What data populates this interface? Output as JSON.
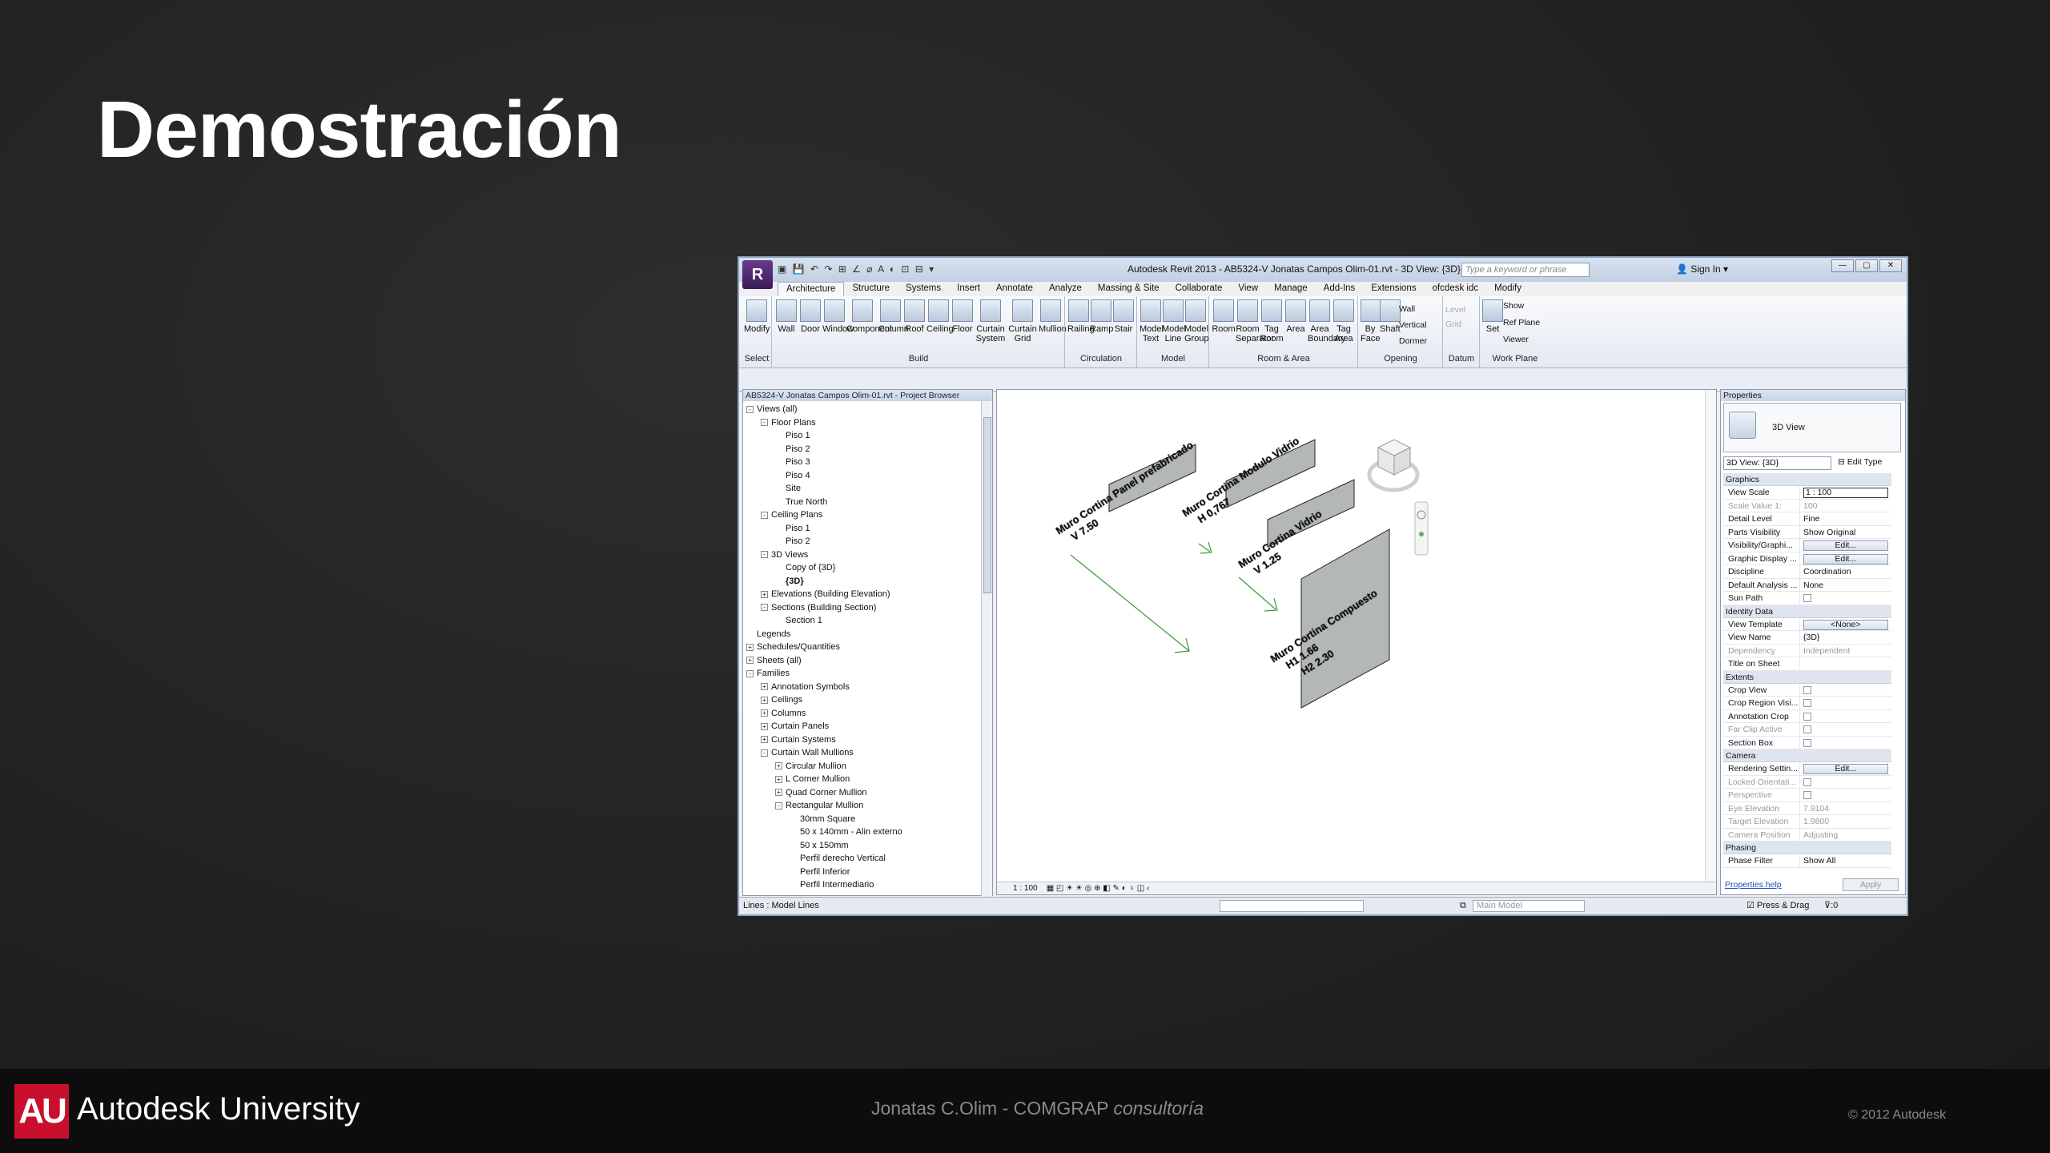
{
  "slide": {
    "title": "Demostración",
    "brand": "Autodesk University",
    "brand_logo": "AU",
    "presenter_name": "Jonatas C.Olim - COMGRAP",
    "presenter_role": "consultoría",
    "copyright": "© 2012 Autodesk"
  },
  "revit": {
    "window_title": "Autodesk Revit 2013 -    AB5324-V Jonatas Campos Olim-01.rvt - 3D View: {3D}",
    "search_placeholder": "Type a keyword or phrase",
    "sign_in": "Sign In",
    "tabs": [
      "Architecture",
      "Structure",
      "Systems",
      "Insert",
      "Annotate",
      "Analyze",
      "Massing & Site",
      "Collaborate",
      "View",
      "Manage",
      "Add-Ins",
      "Extensions",
      "ofcdesk idc",
      "Modify"
    ],
    "ribbon": {
      "modify": "Modify",
      "build": [
        "Wall",
        "Door",
        "Window",
        "Component",
        "Column",
        "Roof",
        "Ceiling",
        "Floor",
        "Curtain System",
        "Curtain Grid",
        "Mullion"
      ],
      "circulation": [
        "Railing",
        "Ramp",
        "Stair"
      ],
      "model": [
        "Model Text",
        "Model Line",
        "Model Group"
      ],
      "room": [
        "Room",
        "Room Separator",
        "Tag Room",
        "Area",
        "Area Boundary",
        "Tag Area"
      ],
      "opening": [
        "By Face",
        "Shaft",
        "Wall",
        "Vertical",
        "Dormer"
      ],
      "datum": [
        "Level",
        "Grid"
      ],
      "workplane": [
        "Set",
        "Show",
        "Ref Plane",
        "Viewer"
      ],
      "panels": [
        "Select",
        "Build",
        "Circulation",
        "Model",
        "Room & Area",
        "Opening",
        "Datum",
        "Work Plane"
      ]
    },
    "project_browser": {
      "title": "AB5324-V Jonatas Campos Olim-01.rvt - Project Browser",
      "items": [
        {
          "t": "Views (all)",
          "l": 0,
          "s": "-"
        },
        {
          "t": "Floor Plans",
          "l": 1,
          "s": "-"
        },
        {
          "t": "Piso 1",
          "l": 2,
          "s": ""
        },
        {
          "t": "Piso 2",
          "l": 2,
          "s": ""
        },
        {
          "t": "Piso 3",
          "l": 2,
          "s": ""
        },
        {
          "t": "Piso 4",
          "l": 2,
          "s": ""
        },
        {
          "t": "Site",
          "l": 2,
          "s": ""
        },
        {
          "t": "True North",
          "l": 2,
          "s": ""
        },
        {
          "t": "Ceiling Plans",
          "l": 1,
          "s": "-"
        },
        {
          "t": "Piso 1",
          "l": 2,
          "s": ""
        },
        {
          "t": "Piso 2",
          "l": 2,
          "s": ""
        },
        {
          "t": "3D Views",
          "l": 1,
          "s": "-"
        },
        {
          "t": "Copy of {3D}",
          "l": 2,
          "s": ""
        },
        {
          "t": "{3D}",
          "l": 2,
          "s": "",
          "b": true
        },
        {
          "t": "Elevations (Building Elevation)",
          "l": 1,
          "s": "+"
        },
        {
          "t": "Sections (Building Section)",
          "l": 1,
          "s": "-"
        },
        {
          "t": "Section 1",
          "l": 2,
          "s": ""
        },
        {
          "t": "Legends",
          "l": 0,
          "s": ""
        },
        {
          "t": "Schedules/Quantities",
          "l": 0,
          "s": "+"
        },
        {
          "t": "Sheets (all)",
          "l": 0,
          "s": "+"
        },
        {
          "t": "Families",
          "l": 0,
          "s": "-"
        },
        {
          "t": "Annotation Symbols",
          "l": 1,
          "s": "+"
        },
        {
          "t": "Ceilings",
          "l": 1,
          "s": "+"
        },
        {
          "t": "Columns",
          "l": 1,
          "s": "+"
        },
        {
          "t": "Curtain Panels",
          "l": 1,
          "s": "+"
        },
        {
          "t": "Curtain Systems",
          "l": 1,
          "s": "+"
        },
        {
          "t": "Curtain Wall Mullions",
          "l": 1,
          "s": "-"
        },
        {
          "t": "Circular Mullion",
          "l": 2,
          "s": "+"
        },
        {
          "t": "L Corner Mullion",
          "l": 2,
          "s": "+"
        },
        {
          "t": "Quad Corner Mullion",
          "l": 2,
          "s": "+"
        },
        {
          "t": "Rectangular Mullion",
          "l": 2,
          "s": "-"
        },
        {
          "t": "30mm Square",
          "l": 3,
          "s": ""
        },
        {
          "t": "50 x 140mm - Alin externo",
          "l": 3,
          "s": ""
        },
        {
          "t": "50 x 150mm",
          "l": 3,
          "s": ""
        },
        {
          "t": "Perfil derecho Vertical",
          "l": 3,
          "s": ""
        },
        {
          "t": "Perfil Inferior",
          "l": 3,
          "s": ""
        },
        {
          "t": "Perfil Intermediario",
          "l": 3,
          "s": ""
        }
      ]
    },
    "view": {
      "annotations": [
        {
          "l1": "Muro Cortina Panel prefabricado",
          "l2": "V 7.50",
          "l3": ""
        },
        {
          "l1": "Muro Cortina Modulo Vidrio",
          "l2": "H 0,767",
          "l3": ""
        },
        {
          "l1": "Muro Cortina Vidrio",
          "l2": "V 1.25",
          "l3": ""
        },
        {
          "l1": "Muro Cortina Compuesto",
          "l2": "H1 1.66",
          "l3": "H2 2.30"
        }
      ],
      "scale": "1 : 100",
      "viewcube_faces": [
        "TOP",
        "FRONT",
        "RIGHT"
      ]
    },
    "properties": {
      "title": "Properties",
      "type_name": "3D View",
      "instance": "3D View: {3D}",
      "edit_type": "Edit Type",
      "groups": [
        {
          "name": "Graphics",
          "rows": [
            {
              "k": "View Scale",
              "v": "1 : 100",
              "kind": "input"
            },
            {
              "k": "Scale Value    1:",
              "v": "100",
              "kind": "dim"
            },
            {
              "k": "Detail Level",
              "v": "Fine"
            },
            {
              "k": "Parts Visibility",
              "v": "Show Original"
            },
            {
              "k": "Visibility/Graphi...",
              "v": "Edit...",
              "kind": "btn"
            },
            {
              "k": "Graphic Display ...",
              "v": "Edit...",
              "kind": "btn"
            },
            {
              "k": "Discipline",
              "v": "Coordination"
            },
            {
              "k": "Default Analysis ...",
              "v": "None"
            },
            {
              "k": "Sun Path",
              "v": "",
              "kind": "chk"
            }
          ]
        },
        {
          "name": "Identity Data",
          "rows": [
            {
              "k": "View Template",
              "v": "<None>",
              "kind": "btn"
            },
            {
              "k": "View Name",
              "v": "{3D}"
            },
            {
              "k": "Dependency",
              "v": "Independent",
              "kind": "dim"
            },
            {
              "k": "Title on Sheet",
              "v": ""
            }
          ]
        },
        {
          "name": "Extents",
          "rows": [
            {
              "k": "Crop View",
              "v": "",
              "kind": "chk"
            },
            {
              "k": "Crop Region Visi...",
              "v": "",
              "kind": "chk"
            },
            {
              "k": "Annotation Crop",
              "v": "",
              "kind": "chk"
            },
            {
              "k": "Far Clip Active",
              "v": "",
              "kind": "chkdim"
            },
            {
              "k": "Section Box",
              "v": "",
              "kind": "chk"
            }
          ]
        },
        {
          "name": "Camera",
          "rows": [
            {
              "k": "Rendering Settin...",
              "v": "Edit...",
              "kind": "btn"
            },
            {
              "k": "Locked Orientati...",
              "v": "",
              "kind": "chkdim"
            },
            {
              "k": "Perspective",
              "v": "",
              "kind": "chkdim"
            },
            {
              "k": "Eye Elevation",
              "v": "7.9104",
              "kind": "dim"
            },
            {
              "k": "Target Elevation",
              "v": "1.9800",
              "kind": "dim"
            },
            {
              "k": "Camera Position",
              "v": "Adjusting",
              "kind": "dim"
            }
          ]
        },
        {
          "name": "Phasing",
          "rows": [
            {
              "k": "Phase Filter",
              "v": "Show All"
            }
          ]
        }
      ],
      "help": "Properties help",
      "apply": "Apply"
    },
    "status": {
      "left": "Lines : Model Lines",
      "model": "Main Model",
      "zero1": ":0",
      "press_drag": "Press & Drag",
      "zero2": ":0"
    }
  }
}
